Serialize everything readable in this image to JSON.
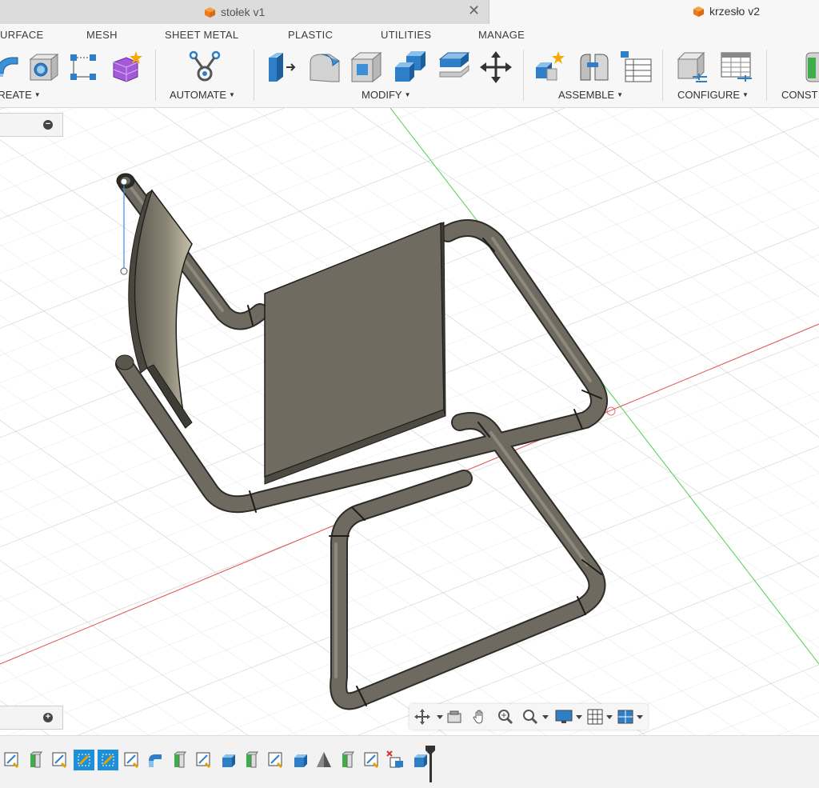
{
  "tabs": [
    {
      "title": "stołek v1",
      "active": false,
      "close_symbol": "✕"
    },
    {
      "title": "krzesło v2",
      "active": true
    }
  ],
  "workspace_tabs": [
    "URFACE",
    "MESH",
    "SHEET METAL",
    "PLASTIC",
    "UTILITIES",
    "MANAGE"
  ],
  "toolbar_groups": {
    "create": "CREATE",
    "automate": "AUTOMATE",
    "modify": "MODIFY",
    "assemble": "ASSEMBLE",
    "configure": "CONFIGURE",
    "construct": "CONST"
  },
  "tools": {
    "create": [
      "revolve-icon",
      "hole-icon",
      "sketch-constraint-icon",
      "form-icon"
    ],
    "automate": [
      "automate-icon"
    ],
    "modify": [
      "press-pull-icon",
      "fillet-icon",
      "shell-icon",
      "combine-icon",
      "offset-face-icon",
      "move-icon"
    ],
    "assemble": [
      "new-component-icon",
      "joint-icon",
      "table-icon"
    ],
    "configure": [
      "configure-icon",
      "configure-table-icon"
    ],
    "construct": [
      "plane-icon"
    ]
  },
  "panels": {
    "browser_collapse": "−",
    "comments_expand": "+"
  },
  "nav_bar": [
    "orbit-icon",
    "look-at-icon",
    "pan-icon",
    "zoom-icon",
    "fit-icon",
    "display-icon",
    "grid-icon",
    "viewports-icon"
  ],
  "timeline": {
    "items": [
      "sketch",
      "extrude",
      "sketch",
      "sketch",
      "sketch",
      "sketch",
      "sweep",
      "extrude",
      "sketch",
      "box",
      "extrude",
      "sketch",
      "box",
      "draft",
      "extrude",
      "sketch",
      "delete-sketch",
      "box"
    ],
    "selected": [
      3,
      4
    ]
  },
  "colors": {
    "x_axis": "#e05050",
    "y_axis": "#4fd14f",
    "model": "#6e6a60",
    "selection": "#1e90d8"
  }
}
